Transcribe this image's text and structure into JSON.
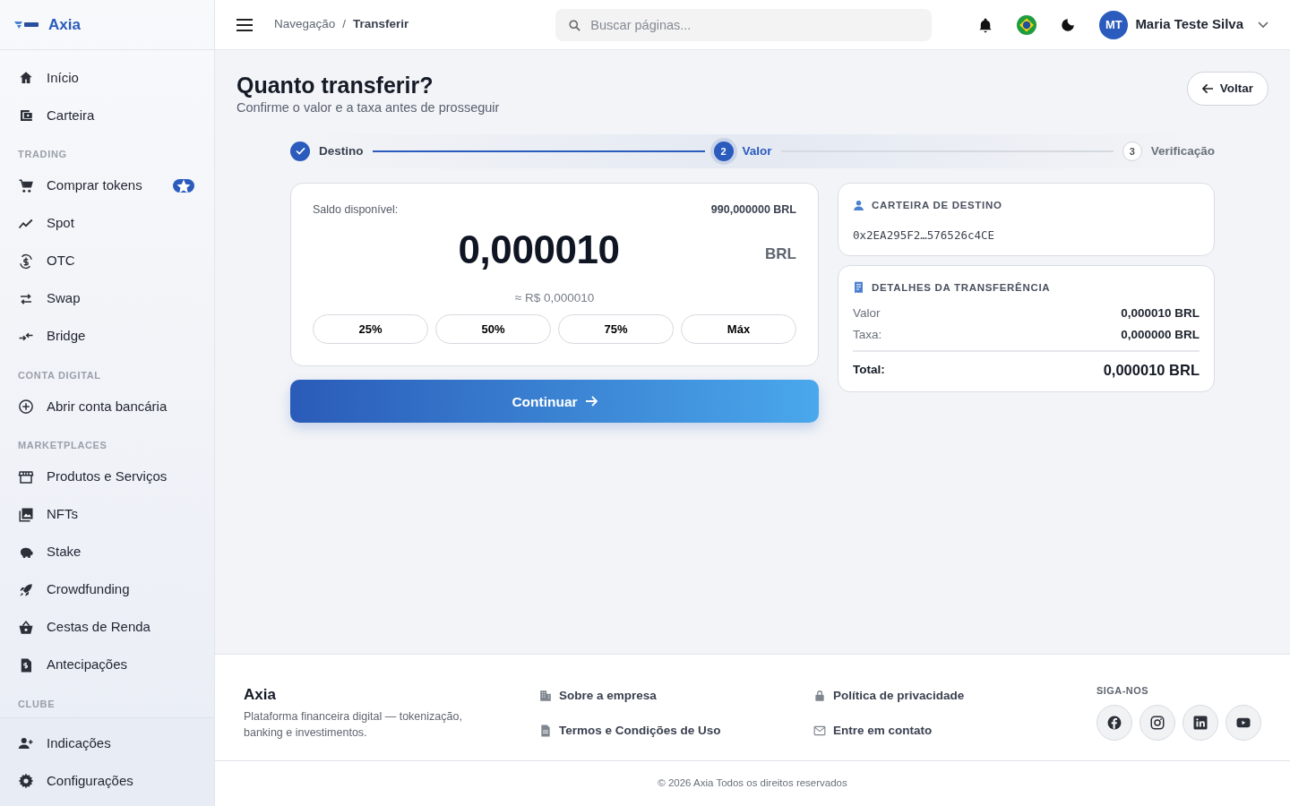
{
  "sidebar": {
    "brand": "Axia",
    "sections": [
      {
        "items": [
          {
            "label": "Início",
            "featured": false
          },
          {
            "label": "Carteira",
            "featured": false
          }
        ]
      },
      {
        "title": "TRADING",
        "items": [
          {
            "label": "Comprar tokens",
            "featured": true
          },
          {
            "label": "Spot",
            "featured": false
          },
          {
            "label": "OTC",
            "featured": false
          },
          {
            "label": "Swap",
            "featured": false
          },
          {
            "label": "Bridge",
            "featured": false
          }
        ]
      },
      {
        "title": "CONTA DIGITAL",
        "items": [
          {
            "label": "Abrir conta bancária",
            "featured": false
          }
        ]
      },
      {
        "title": "MARKETPLACES",
        "items": [
          {
            "label": "Produtos e Serviços",
            "featured": false
          },
          {
            "label": "NFTs",
            "featured": false
          },
          {
            "label": "Stake",
            "featured": false
          },
          {
            "label": "Crowdfunding",
            "featured": false
          },
          {
            "label": "Cestas de Renda",
            "featured": false
          }
        ]
      },
      {
        "items": [
          {
            "label": "Antecipações",
            "featured": false
          }
        ]
      },
      {
        "title": "CLUBE"
      }
    ],
    "bottom_items": [
      {
        "label": "Indicações"
      },
      {
        "label": "Configurações"
      }
    ]
  },
  "header": {
    "breadcrumb": [
      "Navegação",
      "Transferir"
    ],
    "breadcrumb_separator": "/",
    "search": {
      "placeholder": "Buscar páginas..."
    },
    "user": {
      "initials": "MT",
      "name": "Maria Teste Silva"
    }
  },
  "page": {
    "title": "Quanto transferir?",
    "subtitle": "Confirme o valor e a taxa antes de prosseguir",
    "back_button": "Voltar"
  },
  "stepper": [
    {
      "label": "Destino",
      "completed": true,
      "selected": false
    },
    {
      "label": "Valor",
      "number": "2",
      "completed": false,
      "selected": true
    },
    {
      "label": "Verificação",
      "number": "3",
      "completed": false,
      "selected": false
    }
  ],
  "amount_card": {
    "balance_label": "Saldo disponível:",
    "balance_value": "990,000000 BRL",
    "amount": "0,000010",
    "currency": "BRL",
    "approx": "≈ R$ 0,000010",
    "quick_buttons": [
      "25%",
      "50%",
      "75%",
      "Máx"
    ]
  },
  "continue_button": "Continuar",
  "destination": {
    "title": "CARTEIRA DE DESTINO",
    "address": "0x2EA295F2…576526c4CE"
  },
  "details": {
    "title": "DETALHES DA TRANSFERÊNCIA",
    "rows": [
      {
        "label": "Valor",
        "value": "0,000010 BRL"
      },
      {
        "label": "Taxa:",
        "value": "0,000000 BRL"
      }
    ],
    "total": {
      "label": "Total:",
      "value": "0,000010 BRL"
    }
  },
  "footer": {
    "brand": "Axia",
    "tagline": "Plataforma financeira digital — tokenização, banking e investimentos.",
    "links": [
      {
        "label": "Sobre a empresa"
      },
      {
        "label": "Política de privacidade"
      },
      {
        "label": "Termos e Condições de Uso"
      },
      {
        "label": "Entre em contato"
      }
    ],
    "follow_title": "SIGA-NOS",
    "copyright": "© 2026 Axia Todos os direitos reservados"
  }
}
